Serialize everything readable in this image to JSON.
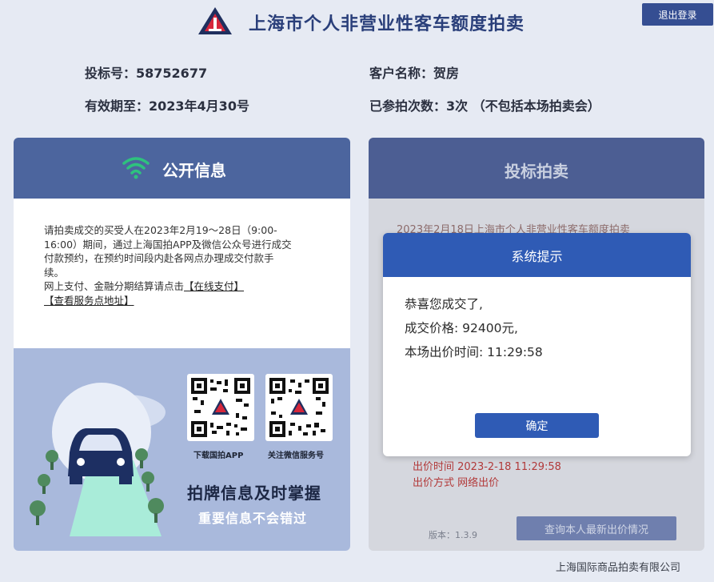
{
  "header": {
    "title": "上海市个人非营业性客车额度拍卖",
    "logout_label": "退出登录"
  },
  "info": {
    "bid_no_label": "投标号：",
    "bid_no": "58752677",
    "customer_label": "客户名称：",
    "customer": "贺房",
    "valid_label": "有效期至：",
    "valid": "2023年4月30号",
    "count_label": "已参拍次数：",
    "count": "3次 （不包括本场拍卖会）"
  },
  "public_info": {
    "title": "公开信息",
    "notice_lines": [
      "请拍卖成交的买受人在2023年2月19～28日（9:00-",
      "16:00）期间，通过上海国拍APP及微信公众号进行成交",
      "付款预约，在预约时间段内赴各网点办理成交付款手",
      "续。"
    ],
    "online_prefix": "网上支付、金融分期结算请点击",
    "online_pay_link": "【在线支付】",
    "service_link": "【查看服务点地址】",
    "qr_app_label": "下载国拍APP",
    "qr_wechat_label": "关注微信服务号",
    "slogan_main": "拍牌信息及时掌握",
    "slogan_sub": "重要信息不会错过"
  },
  "auction": {
    "title": "投标拍卖",
    "bg_line": "2023年2月18日上海市个人非营业性客车额度拍卖",
    "bid_time": "出价时间 2023-2-18 11:29:58",
    "bid_method": "出价方式 网络出价",
    "version": "版本：1.3.9",
    "query_label": "查询本人最新出价情况"
  },
  "modal": {
    "title": "系统提示",
    "line1": "恭喜您成交了,",
    "line2": "成交价格:  92400元,",
    "line3": "本场出价时间:  11:29:58",
    "ok_label": "确定"
  },
  "footer": {
    "company": "上海国际商品拍卖有限公司"
  },
  "colors": {
    "brand_blue": "#2f5bb5",
    "header_blue": "#4c659e",
    "logo_red": "#d6263b",
    "logo_navy": "#1f2f5e"
  },
  "icons": {
    "logo": "triangle-logo-icon",
    "wifi": "wifi-icon",
    "car": "car-icon"
  }
}
